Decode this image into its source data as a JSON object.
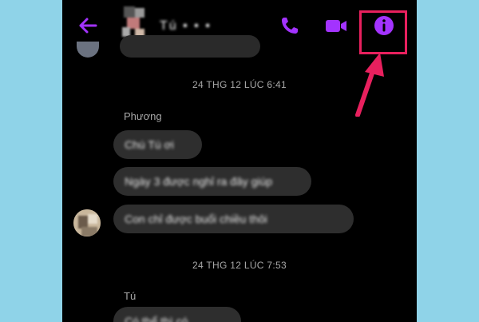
{
  "header": {
    "contact_name": "Tú • • •",
    "icons": [
      "back-arrow-icon",
      "phone-icon",
      "video-icon",
      "info-icon"
    ]
  },
  "colors": {
    "accent": "#a333ff",
    "highlight": "#e8205e",
    "bubble": "#2e2e2e",
    "background": "#000000"
  },
  "conversation": {
    "timestamp_1": "24 THG 12 LÚC 6:41",
    "sender_1": "Phương",
    "messages_1": [
      "Chú Tú ơi",
      "Ngày 3 được nghỉ ra đây giúp",
      "Con chỉ được buổi chiều thôi"
    ],
    "timestamp_2": "24 THG 12 LÚC 7:53",
    "sender_2": "Tú",
    "messages_2": [
      "Có thể thì có"
    ]
  }
}
